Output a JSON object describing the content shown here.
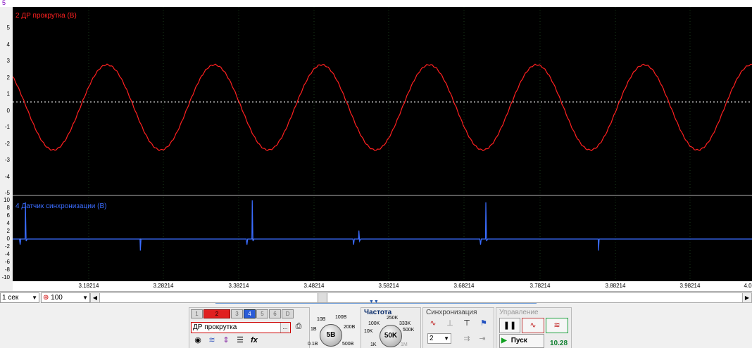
{
  "top_marker": "5",
  "channel2": {
    "label": "2 ДР прокрутка (В)",
    "color": "#ff2020",
    "y_ticks": [
      "5",
      "4",
      "3",
      "2",
      "1",
      "0",
      "-1",
      "-2",
      "-3",
      "-4",
      "-5"
    ]
  },
  "channel4": {
    "label": "4 Датчик синхронизации (В)",
    "color": "#3a6cff",
    "y_ticks": [
      "10",
      "8",
      "6",
      "4",
      "2",
      "0",
      "-2",
      "-4",
      "-6",
      "-8",
      "-10"
    ]
  },
  "x_ticks": [
    "3.18214",
    "3.28214",
    "3.38214",
    "3.48214",
    "3.58214",
    "3.68214",
    "3.78214",
    "3.88214",
    "3.98214",
    "4.0"
  ],
  "controls": {
    "time_scale": "1 сек",
    "zoom": "100"
  },
  "channels_panel": {
    "buttons": [
      "1",
      "2",
      "3",
      "4",
      "5",
      "6",
      "D"
    ],
    "active_red": "2",
    "active_blue": "4",
    "selected_channel": "ДР прокрутка",
    "selected_channel_ellipsis": "...",
    "knob_value": "5В",
    "knob_labels": [
      "10В",
      "100В",
      "1В",
      "200В",
      "0.1В",
      "500В"
    ]
  },
  "frequency_panel": {
    "title": "Частота",
    "knob_value": "50K",
    "knob_labels": [
      "250K",
      "100K",
      "333K",
      "10K",
      "500K",
      "1K",
      "1M"
    ]
  },
  "sync_panel": {
    "title": "Синхронизация",
    "select_value": "2"
  },
  "control_panel": {
    "title": "Управление",
    "start_label": "Пуск",
    "counter": "10.28"
  },
  "chart_data": [
    {
      "type": "line",
      "series": [
        {
          "name": "2 ДР прокрутка (В)"
        }
      ],
      "x_range": [
        3.14,
        4.0
      ],
      "ylim": [
        -5,
        5
      ],
      "waveform": "sine",
      "amplitude_high": 2.05,
      "amplitude_low": -2.65,
      "period_s": 0.143
    },
    {
      "type": "line",
      "series": [
        {
          "name": "4 Датчик синхронизации (В)"
        }
      ],
      "ylim": [
        -10,
        10
      ],
      "spikes": [
        {
          "x": 3.149,
          "peak": 9.5
        },
        {
          "x": 3.302,
          "peak": -3.0
        },
        {
          "x": 3.451,
          "peak": 10.0
        },
        {
          "x": 3.593,
          "peak": 2.2
        },
        {
          "x": 3.762,
          "peak": 9.5
        },
        {
          "x": 3.912,
          "peak": -3.0
        }
      ]
    }
  ]
}
